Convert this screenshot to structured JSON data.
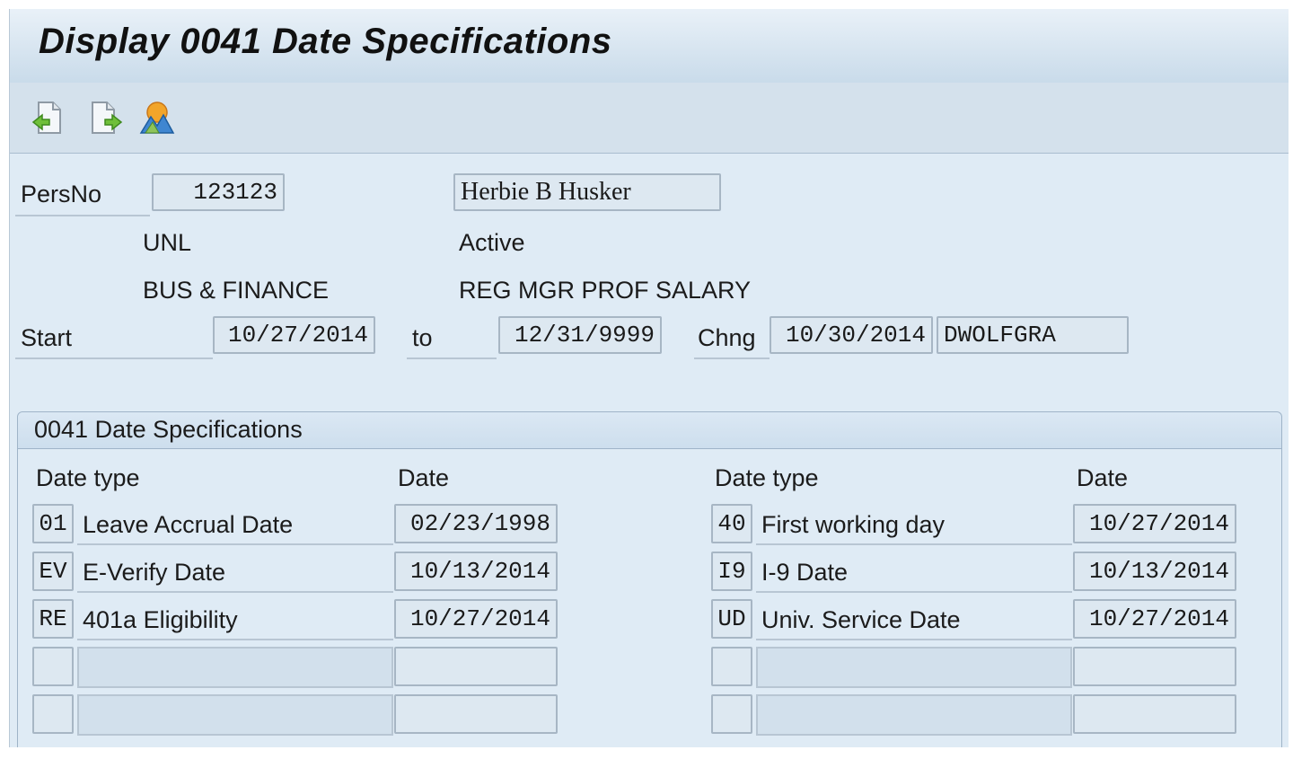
{
  "window": {
    "title": "Display 0041 Date Specifications"
  },
  "toolbar": {
    "icons": [
      "previous-record-icon",
      "next-record-icon",
      "overview-icon"
    ]
  },
  "header": {
    "persno_label": "PersNo",
    "persno_value": "123123",
    "name_value": "Herbie B Husker",
    "org": "UNL",
    "status": "Active",
    "dept": "BUS & FINANCE",
    "position": "REG MGR PROF SALARY",
    "start_label": "Start",
    "start_value": "10/27/2014",
    "to_label": "to",
    "end_value": "12/31/9999",
    "chng_label": "Chng",
    "chng_date": "10/30/2014",
    "chng_user": "DWOLFGRA"
  },
  "group": {
    "title": "0041 Date Specifications",
    "col_date_type": "Date type",
    "col_date": "Date",
    "left_rows": [
      {
        "code": "01",
        "desc": "Leave Accrual Date",
        "date": "02/23/1998"
      },
      {
        "code": "EV",
        "desc": "E-Verify Date",
        "date": "10/13/2014"
      },
      {
        "code": "RE",
        "desc": "401a Eligibility",
        "date": "10/27/2014"
      },
      {
        "code": "",
        "desc": "",
        "date": ""
      },
      {
        "code": "",
        "desc": "",
        "date": ""
      }
    ],
    "right_rows": [
      {
        "code": "40",
        "desc": "First working day",
        "date": "10/27/2014"
      },
      {
        "code": "I9",
        "desc": "I-9 Date",
        "date": "10/13/2014"
      },
      {
        "code": "UD",
        "desc": "Univ. Service Date",
        "date": "10/27/2014"
      },
      {
        "code": "",
        "desc": "",
        "date": ""
      },
      {
        "code": "",
        "desc": "",
        "date": ""
      }
    ]
  }
}
